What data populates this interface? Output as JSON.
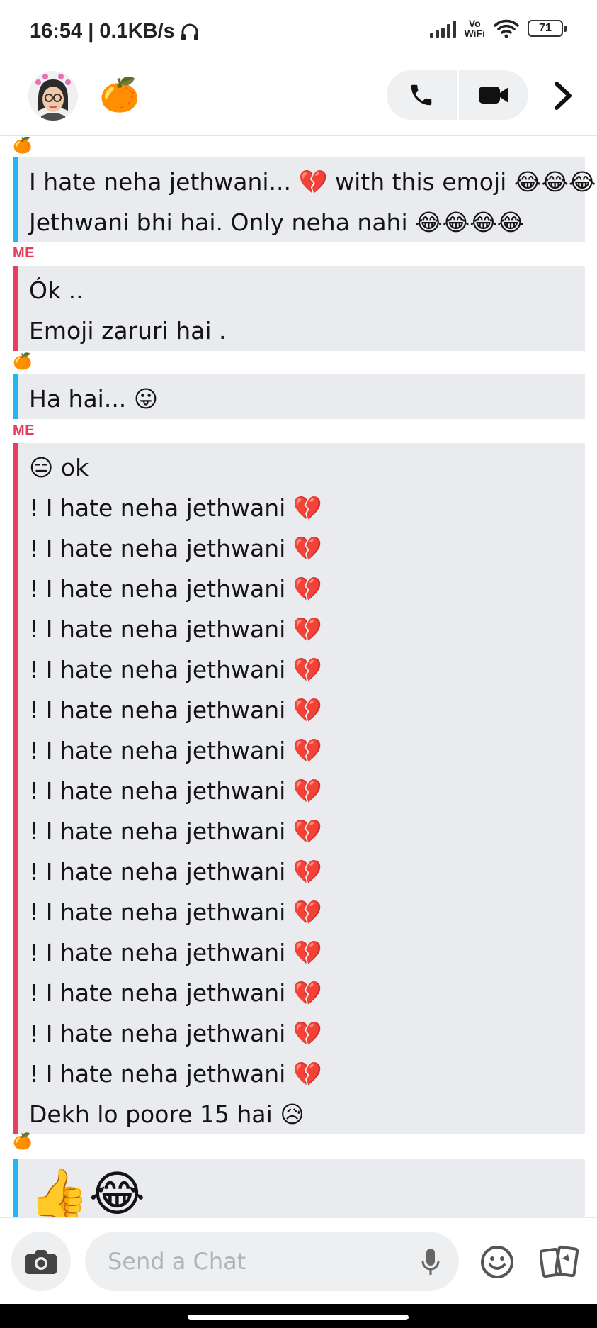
{
  "status_bar": {
    "time_speed": "16:54 | 0.1KB/s",
    "network_label_1": "Vo",
    "network_label_2": "WiFi",
    "battery": "71"
  },
  "header": {
    "friend_emoji": "🍊",
    "icons": [
      "bitmoji-avatar",
      "phone-icon",
      "video-camera-icon",
      "chevron-right-icon"
    ]
  },
  "chat": {
    "sender_friend": "🍊",
    "sender_me": "ME",
    "group1": [
      "I hate neha jethwani... 💔 with this emoji 😂😂😂",
      "Jethwani bhi hai. Only neha nahi 😂😂😂😂"
    ],
    "group2": [
      "Ók ..",
      "Emoji zaruri hai ."
    ],
    "group3": [
      "Ha hai... 😛"
    ],
    "group4": [
      "😑 ok",
      "! I hate neha jethwani 💔",
      "! I hate neha jethwani 💔",
      "! I hate neha jethwani 💔",
      "! I hate neha jethwani 💔",
      "! I hate neha jethwani 💔",
      "! I hate neha jethwani 💔",
      "! I hate neha jethwani 💔",
      "! I hate neha jethwani 💔",
      "! I hate neha jethwani 💔",
      "! I hate neha jethwani 💔",
      "! I hate neha jethwani 💔",
      "! I hate neha jethwani 💔",
      "! I hate neha jethwani 💔",
      "! I hate neha jethwani 💔",
      "! I hate neha jethwani 💔",
      "Dekh lo poore 15 hai 😥"
    ],
    "group5": [
      "👍😂"
    ]
  },
  "composer": {
    "placeholder": "Send a Chat",
    "icons": [
      "camera-icon",
      "microphone-icon",
      "smiley-icon",
      "cards-icon"
    ]
  },
  "colors": {
    "friend_accent": "#21b6ee",
    "me_accent": "#e6405f",
    "me_label": "#e0405e",
    "bubble_bg": "#e9ebee"
  }
}
